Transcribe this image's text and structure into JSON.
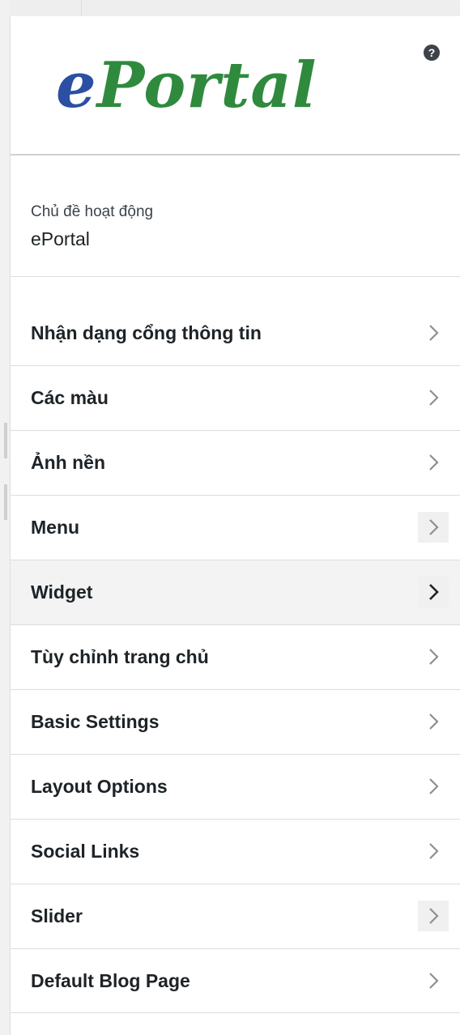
{
  "header": {
    "logo_e": "e",
    "logo_rest": "Portal",
    "help_icon": "help-icon"
  },
  "active_theme": {
    "label": "Chủ đề hoạt động",
    "name": "ePortal"
  },
  "sections": [
    {
      "title": "Nhận dạng cổng thông tin"
    },
    {
      "title": "Các màu"
    },
    {
      "title": "Ảnh nền"
    },
    {
      "title": "Menu"
    },
    {
      "title": "Widget"
    },
    {
      "title": "Tùy chỉnh trang chủ"
    },
    {
      "title": "Basic Settings"
    },
    {
      "title": "Layout Options"
    },
    {
      "title": "Social Links"
    },
    {
      "title": "Slider"
    },
    {
      "title": "Default Blog Page"
    }
  ],
  "colors": {
    "logo_blue": "#2b4fa3",
    "logo_green": "#2f8a3e",
    "text": "#1d2327",
    "chevron": "#8c8f94",
    "chevron_active": "#1d2327"
  }
}
